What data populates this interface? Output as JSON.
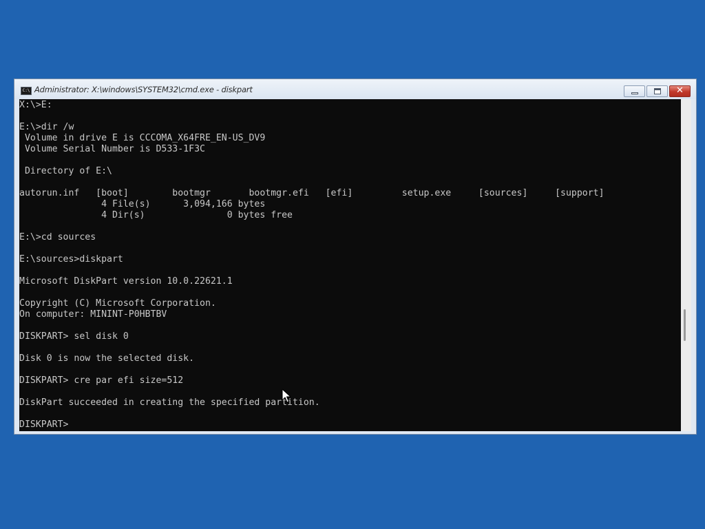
{
  "window": {
    "title": "Administrator: X:\\windows\\SYSTEM32\\cmd.exe - diskpart",
    "icon_text": "C:\\",
    "icon": "cmd-icon",
    "buttons": {
      "minimize": "minimize-icon",
      "maximize": "maximize-icon",
      "close": "close-icon",
      "close_glyph": "✕"
    }
  },
  "console": {
    "lines": [
      "X:\\>E:",
      "",
      "E:\\>dir /w",
      " Volume in drive E is CCCOMA_X64FRE_EN-US_DV9",
      " Volume Serial Number is D533-1F3C",
      "",
      " Directory of E:\\",
      "",
      "autorun.inf   [boot]        bootmgr       bootmgr.efi   [efi]         setup.exe     [sources]     [support]",
      "               4 File(s)      3,094,166 bytes",
      "               4 Dir(s)               0 bytes free",
      "",
      "E:\\>cd sources",
      "",
      "E:\\sources>diskpart",
      "",
      "Microsoft DiskPart version 10.0.22621.1",
      "",
      "Copyright (C) Microsoft Corporation.",
      "On computer: MININT-P0HBTBV",
      "",
      "DISKPART> sel disk 0",
      "",
      "Disk 0 is now the selected disk.",
      "",
      "DISKPART> cre par efi size=512",
      "",
      "DiskPart succeeded in creating the specified partition.",
      "",
      "DISKPART> "
    ],
    "text_color": "#c8c8c8",
    "background": "#0c0c0c"
  },
  "scrollbar": {
    "position_fraction": 0.7
  },
  "colors": {
    "desktop": "#1f63b1",
    "close_button": "#c1392b"
  }
}
